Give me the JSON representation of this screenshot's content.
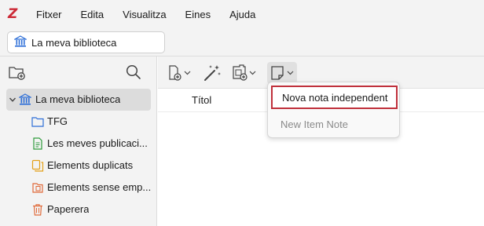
{
  "menubar": {
    "logo": "Z",
    "items": [
      "Fitxer",
      "Edita",
      "Visualitza",
      "Eines",
      "Ajuda"
    ]
  },
  "library_tab": {
    "label": "La meva biblioteca"
  },
  "tree": {
    "root": "La meva biblioteca",
    "children": [
      {
        "label": "TFG",
        "icon": "folder-icon"
      },
      {
        "label": "Les meves publicaci...",
        "icon": "document-icon"
      },
      {
        "label": "Elements duplicats",
        "icon": "duplicate-icon"
      },
      {
        "label": "Elements sense emp...",
        "icon": "unfiled-icon"
      },
      {
        "label": "Paperera",
        "icon": "trash-icon"
      }
    ]
  },
  "items_table": {
    "title_column": "Títol"
  },
  "new_note_menu": {
    "items": [
      {
        "label": "Nova nota independent",
        "enabled": true
      },
      {
        "label": "New Item Note",
        "enabled": false
      }
    ]
  },
  "colors": {
    "brand": "#cc2936",
    "accent_blue": "#2e6fd8",
    "highlight_border": "#c0303b"
  }
}
